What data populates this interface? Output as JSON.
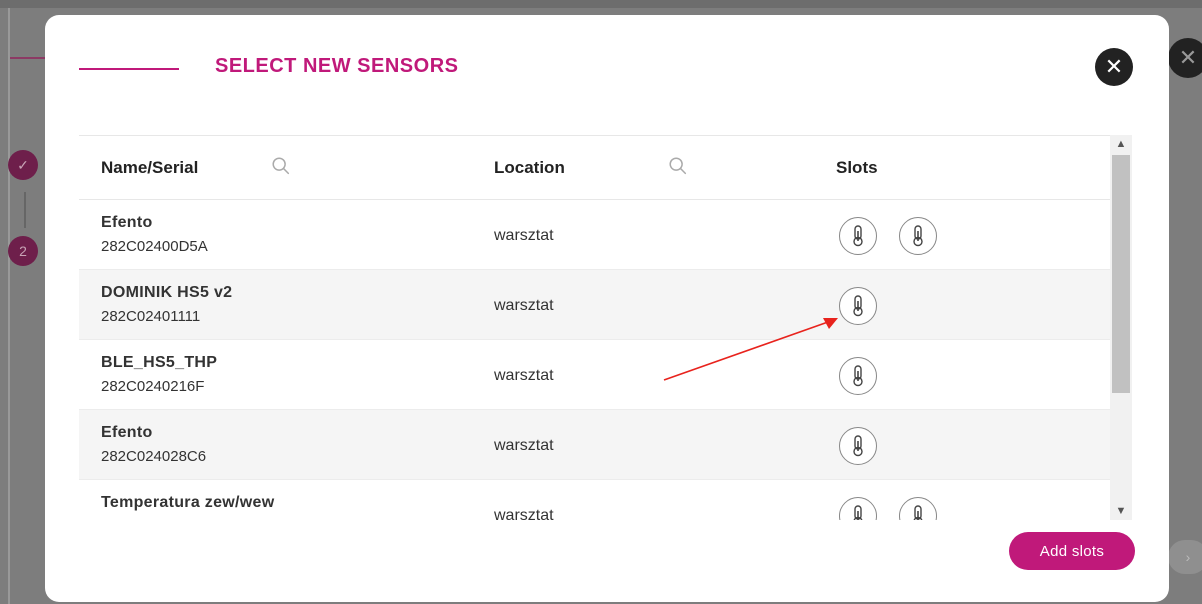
{
  "background": {
    "steps": [
      {
        "label": "✓"
      },
      {
        "label": "2"
      }
    ],
    "close_symbol": "✕",
    "next_symbol": "›"
  },
  "modal": {
    "title": "SELECT NEW SENSORS",
    "close_symbol": "✕",
    "columns": {
      "name": "Name/Serial",
      "location": "Location",
      "slots": "Slots"
    },
    "rows": [
      {
        "name": "Efento",
        "serial": "282C02400D5A",
        "location": "warsztat",
        "slots": 2
      },
      {
        "name": "DOMINIK HS5 v2",
        "serial": "282C02401111",
        "location": "warsztat",
        "slots": 1
      },
      {
        "name": "BLE_HS5_THP",
        "serial": "282C0240216F",
        "location": "warsztat",
        "slots": 1
      },
      {
        "name": "Efento",
        "serial": "282C024028C6",
        "location": "warsztat",
        "slots": 1
      },
      {
        "name": "Temperatura zew/wew",
        "serial": "",
        "location": "warsztat",
        "slots": 2
      }
    ],
    "add_button": "Add slots",
    "scroll_up_symbol": "▲",
    "scroll_down_symbol": "▼"
  },
  "colors": {
    "accent": "#c0197a",
    "annotation_arrow": "#e8231d"
  },
  "icons": [
    "search-icon",
    "thermometer-icon",
    "close-icon",
    "check-icon"
  ]
}
